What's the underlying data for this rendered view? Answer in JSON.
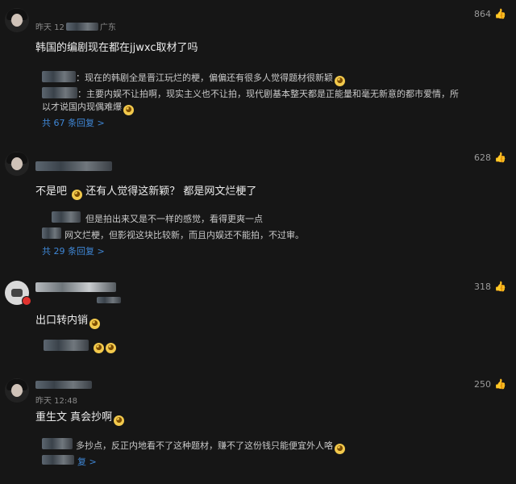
{
  "comments": [
    {
      "meta": "昨天 12",
      "meta_suffix": "广东",
      "likes": "864",
      "text": "韩国的编剧现在都在jjwxc取材了吗",
      "replies": [
        "：现在的韩剧全是晋江玩烂的梗，偏偏还有很多人觉得题材很新颖",
        "：主要内娱不让拍啊，现实主义也不让拍，现代剧基本整天都是正能量和毫无新意的都市爱情，所",
        "以才说国内现偶难爆"
      ],
      "more": "共 67 条回复 >"
    },
    {
      "likes": "628",
      "text": "不是吧 ",
      "text_tail": " 还有人觉得这新颖？ 都是网文烂梗了",
      "replies": [
        "但是拍出来又是不一样的感觉，看得更爽一点",
        "网文烂梗，但影视这块比较新，而且内娱还不能拍，不过审。"
      ],
      "more": "共 29 条回复 >"
    },
    {
      "likes": "318",
      "text": "出口转内销",
      "replies": []
    },
    {
      "meta": "昨天 12:48",
      "likes": "250",
      "text": "重生文 真会抄啊",
      "replies": [
        "多抄点，反正内地看不了这种题材，赚不了这份钱只能便宜外人咯"
      ],
      "more": "复 >"
    }
  ],
  "icons": {
    "like": "thumbs-up-icon",
    "emoji": "face-emoji-icon"
  }
}
